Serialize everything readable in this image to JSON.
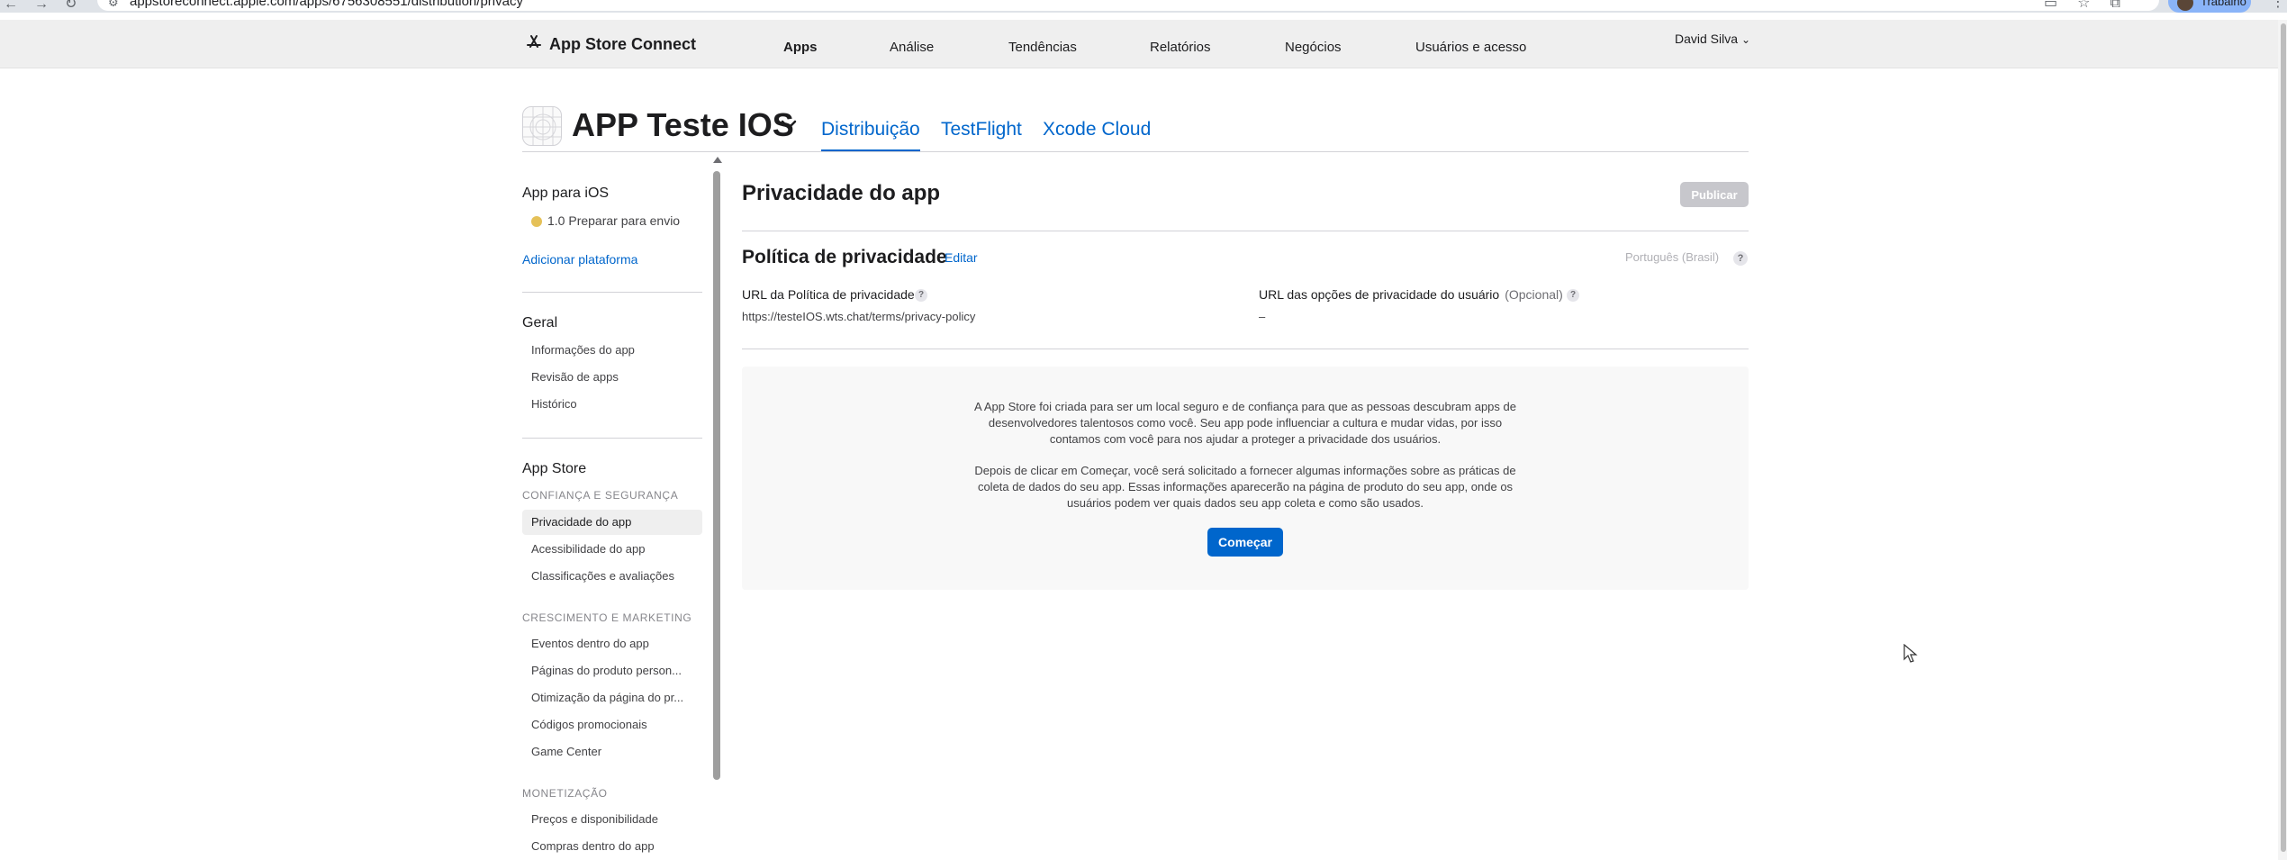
{
  "browser": {
    "url": "appstoreconnect.apple.com/apps/6756308551/distribution/privacy",
    "profile_label": "Trabalho"
  },
  "topnav": {
    "brand": "App Store Connect",
    "items": [
      {
        "label": "Apps",
        "active": true
      },
      {
        "label": "Análise",
        "active": false
      },
      {
        "label": "Tendências",
        "active": false
      },
      {
        "label": "Relatórios",
        "active": false
      },
      {
        "label": "Negócios",
        "active": false
      },
      {
        "label": "Usuários e acesso",
        "active": false
      }
    ],
    "user": "David Silva"
  },
  "app_header": {
    "title": "APP Teste IOS",
    "tabs": [
      {
        "label": "Distribuição",
        "active": true
      },
      {
        "label": "TestFlight",
        "active": false
      },
      {
        "label": "Xcode Cloud",
        "active": false
      }
    ]
  },
  "sidebar": {
    "platform_heading": "App para iOS",
    "version_status": "1.0 Preparar para envio",
    "add_platform": "Adicionar plataforma",
    "general_heading": "Geral",
    "general_items": [
      "Informações do app",
      "Revisão de apps",
      "Histórico"
    ],
    "store_heading": "App Store",
    "trust_section": "CONFIANÇA E SEGURANÇA",
    "trust_items": [
      "Privacidade do app",
      "Acessibilidade do app",
      "Classificações e avaliações"
    ],
    "growth_section": "CRESCIMENTO E MARKETING",
    "growth_items": [
      "Eventos dentro do app",
      "Páginas do produto person...",
      "Otimização da página do pr...",
      "Códigos promocionais",
      "Game Center"
    ],
    "monetization_section": "MONETIZAÇÃO",
    "monetization_items": [
      "Preços e disponibilidade",
      "Compras dentro do app"
    ]
  },
  "main": {
    "title": "Privacidade do app",
    "publish_label": "Publicar",
    "policy_title": "Política de privacidade",
    "edit_label": "Editar",
    "language": "Português (Brasil)",
    "policy_url_label": "URL da Política de privacidade",
    "policy_url_value": "https://testeIOS.wts.chat/terms/privacy-policy",
    "user_choices_label": "URL das opções de privacidade do usuário",
    "user_choices_optional": "(Opcional)",
    "user_choices_value": "–",
    "info_paragraph_1": "A App Store foi criada para ser um local seguro e de confiança para que as pessoas descubram apps de desenvolvedores talentosos como você. Seu app pode influenciar a cultura e mudar vidas, por isso contamos com você para nos ajudar a proteger a privacidade dos usuários.",
    "info_paragraph_2": "Depois de clicar em Começar, você será solicitado a fornecer algumas informações sobre as práticas de coleta de dados do seu app. Essas informações aparecerão na página de produto do seu app, onde os usuários podem ver quais dados seu app coleta e como são usados.",
    "start_label": "Começar",
    "help_glyph": "?"
  },
  "colors": {
    "accent": "#0066cc",
    "status_pending": "#e5c158",
    "disabled_button": "#c7c7cc"
  },
  "icons": [
    "back-icon",
    "forward-icon",
    "reload-icon",
    "site-info-icon",
    "install-icon",
    "star-icon",
    "extensions-icon",
    "app-store-connect-logo-icon",
    "chevron-down-icon",
    "app-placeholder-icon",
    "help-icon",
    "cursor-icon"
  ]
}
